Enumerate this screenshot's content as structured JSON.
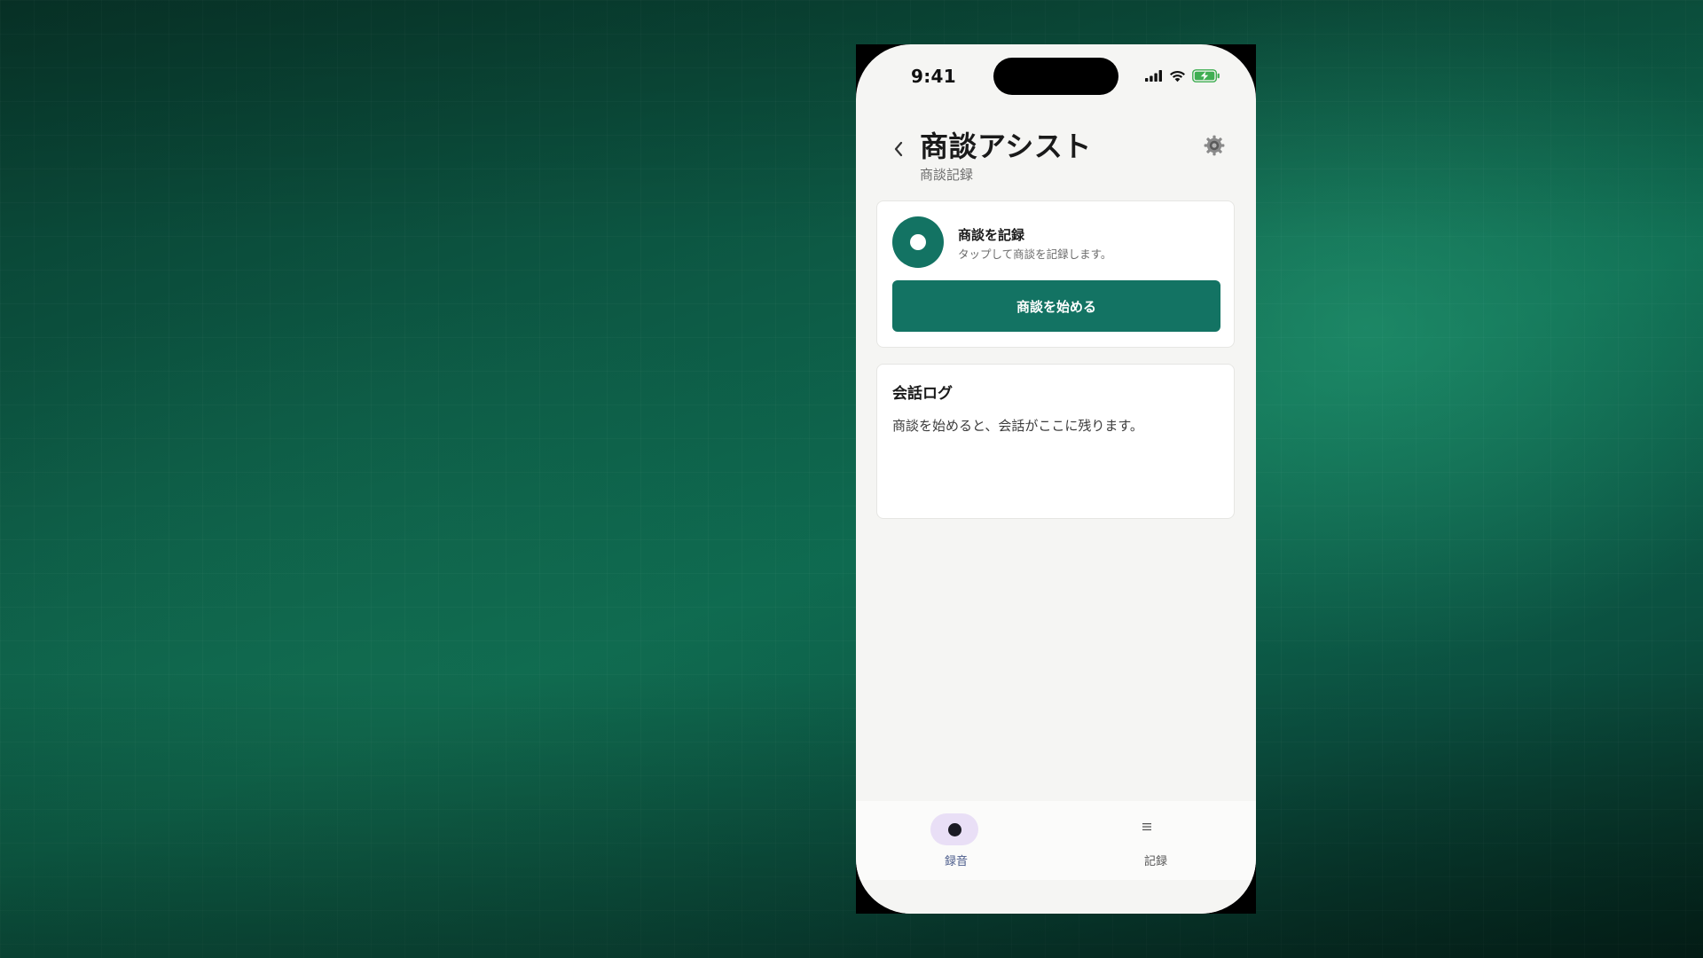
{
  "status_bar": {
    "time": "9:41",
    "icons": [
      "signal-icon",
      "wifi-icon",
      "battery-charging-icon"
    ]
  },
  "header": {
    "title": "商談アシスト",
    "subtitle": "商談記録",
    "back_icon": "chevron-left-icon",
    "settings_icon": "gear-icon"
  },
  "record_card": {
    "title": "商談を記録",
    "description": "タップして商談を記録します。",
    "start_button_label": "商談を始める"
  },
  "log_card": {
    "title": "会話ログ",
    "empty_text": "商談を始めると、会話がここに残ります。"
  },
  "tab_bar": {
    "tabs": [
      {
        "label": "録音",
        "icon": "record-dot-icon",
        "active": true
      },
      {
        "label": "記録",
        "icon": "list-icon",
        "active": false
      }
    ]
  },
  "colors": {
    "accent": "#137363",
    "background_app": "#f5f5f3",
    "tab_active_pill": "#e9dff6",
    "tab_active_label": "#4a5b8a"
  }
}
